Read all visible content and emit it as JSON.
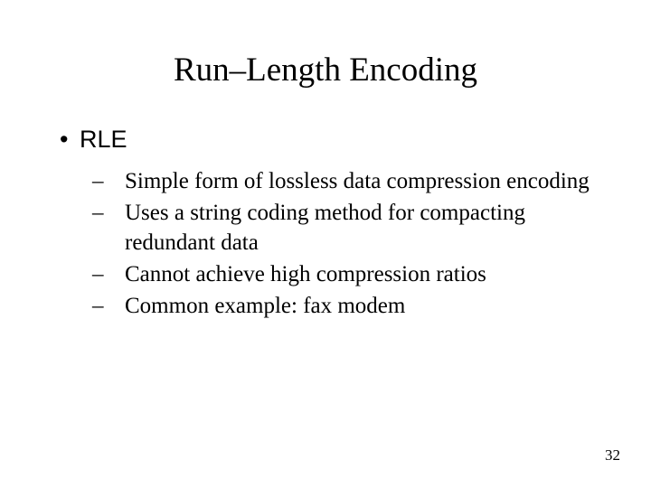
{
  "slide": {
    "title": "Run–Length Encoding",
    "level1": "RLE",
    "subitems": [
      "Simple form of lossless data compression encoding",
      "Uses a string coding method for compacting redundant data",
      "Cannot achieve high compression ratios",
      "Common example:  fax modem"
    ],
    "pageNumber": "32"
  }
}
